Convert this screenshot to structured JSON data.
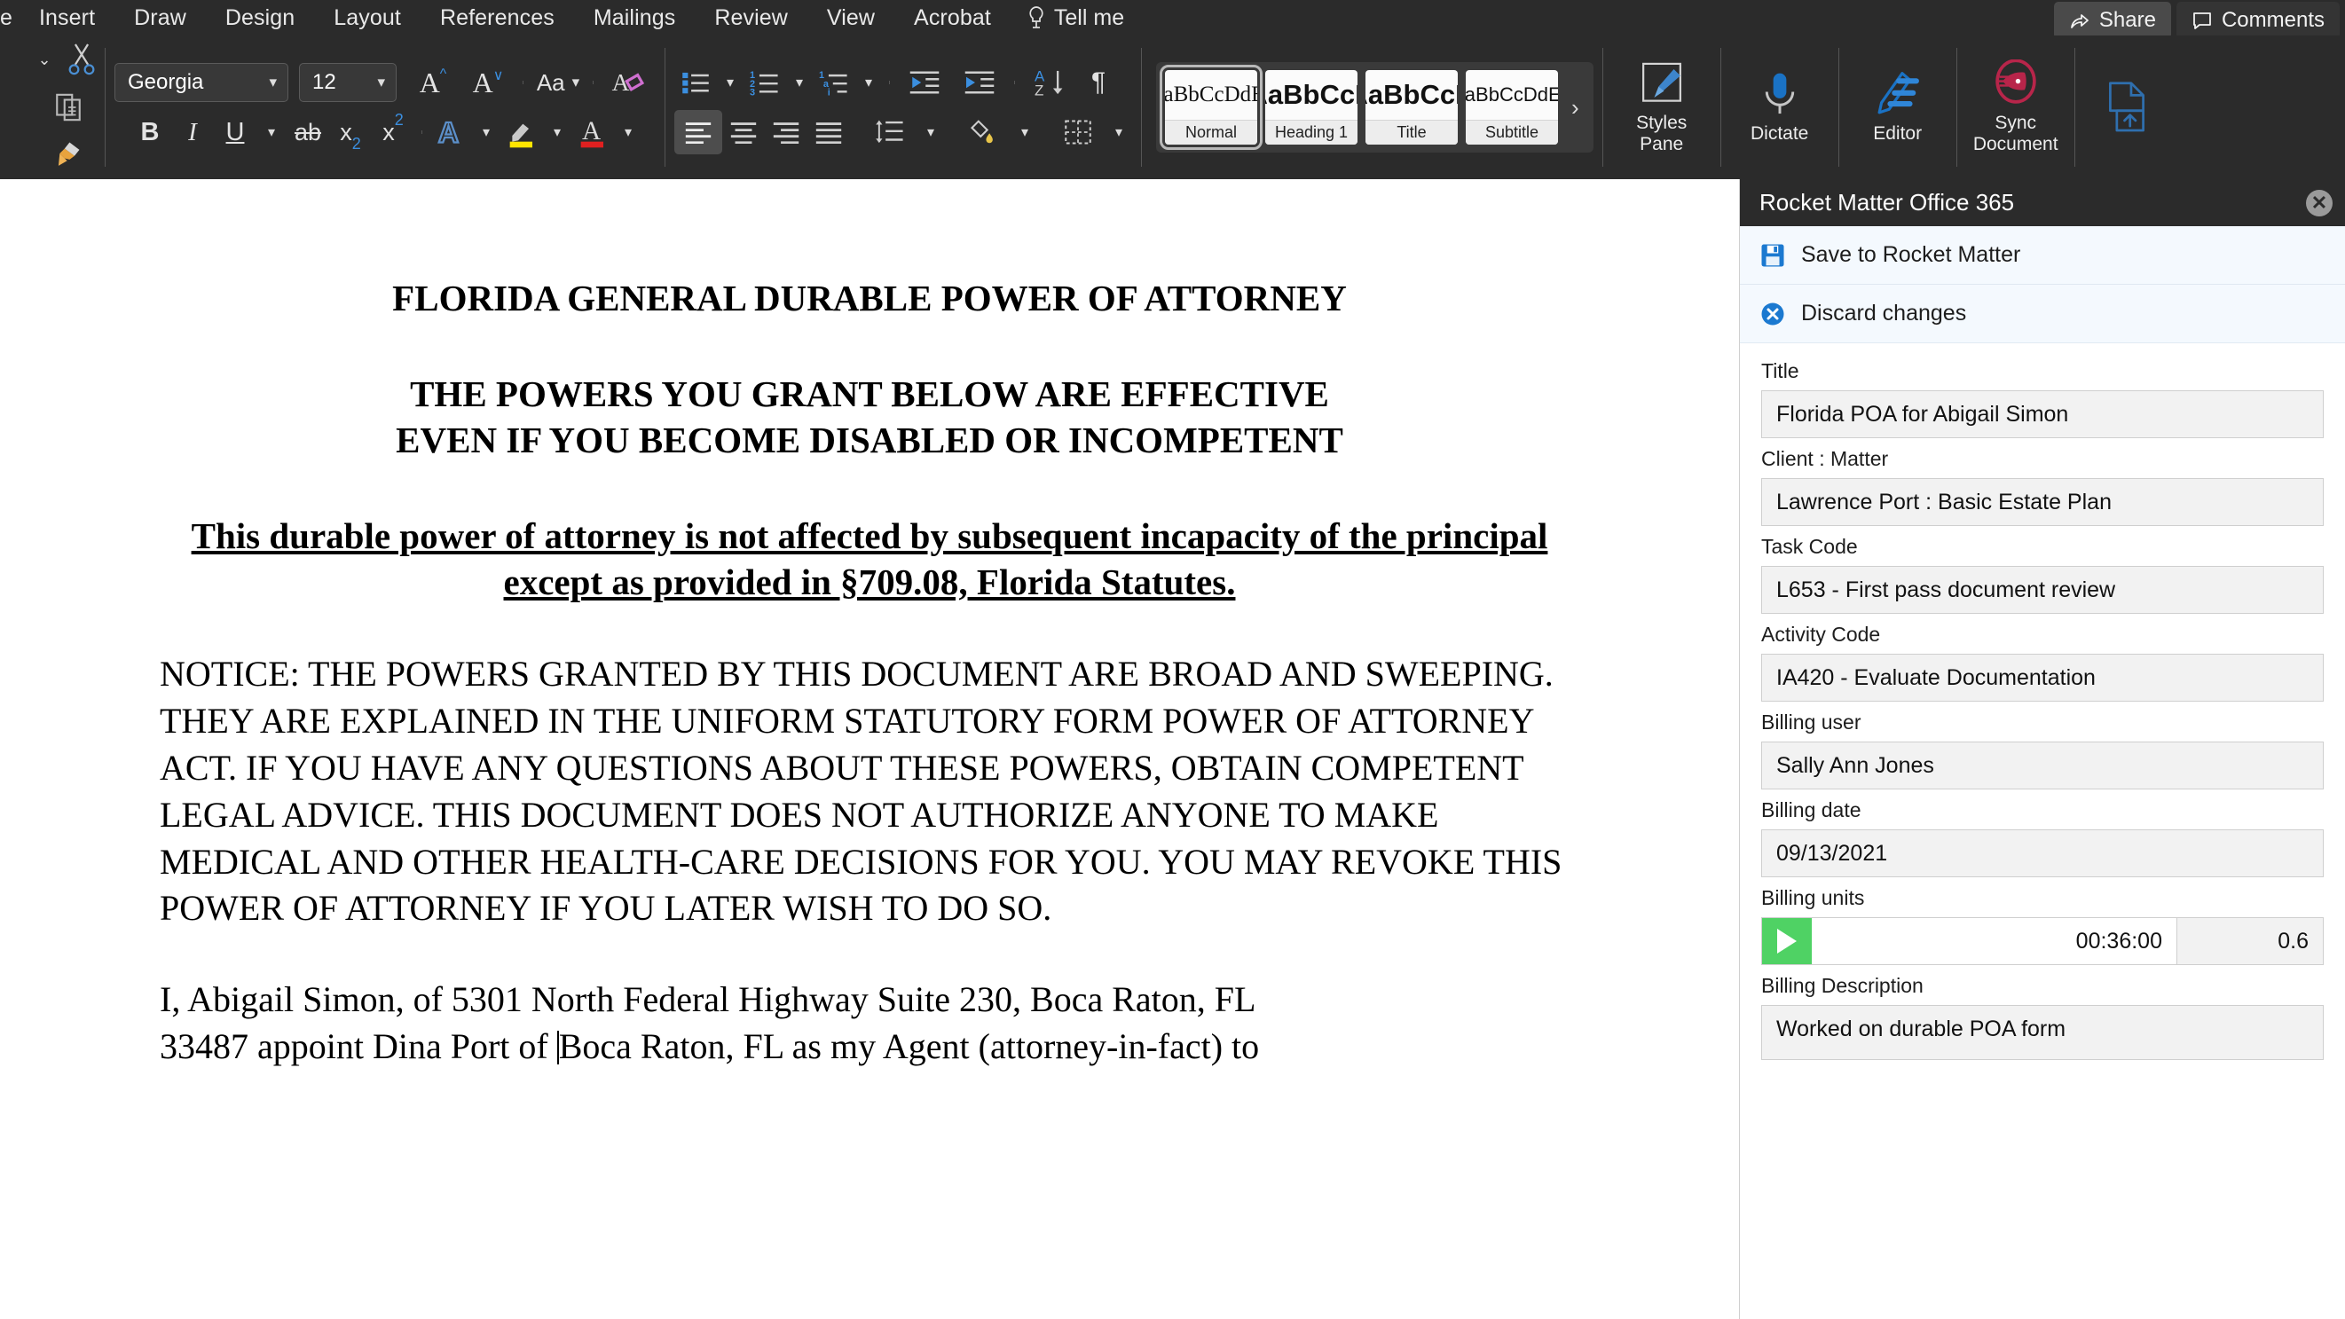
{
  "menubar": {
    "items": [
      {
        "label": "e",
        "name": "menu-home-partial"
      },
      {
        "label": "Insert",
        "name": "menu-insert"
      },
      {
        "label": "Draw",
        "name": "menu-draw"
      },
      {
        "label": "Design",
        "name": "menu-design"
      },
      {
        "label": "Layout",
        "name": "menu-layout"
      },
      {
        "label": "References",
        "name": "menu-references"
      },
      {
        "label": "Mailings",
        "name": "menu-mailings"
      },
      {
        "label": "Review",
        "name": "menu-review"
      },
      {
        "label": "View",
        "name": "menu-view"
      },
      {
        "label": "Acrobat",
        "name": "menu-acrobat"
      }
    ],
    "tell_me": "Tell me",
    "share": "Share",
    "comments": "Comments"
  },
  "ribbon": {
    "font_name": "Georgia",
    "font_size": "12",
    "styles": [
      {
        "preview": "AaBbCcDdEe",
        "label": "Normal",
        "size": "25px",
        "weight": "normal",
        "selected": true
      },
      {
        "preview": "AaBbCcD",
        "label": "Heading 1",
        "size": "32px",
        "weight": "bold",
        "selected": false
      },
      {
        "preview": "AaBbCcD",
        "label": "Title",
        "size": "32px",
        "weight": "bold",
        "selected": false
      },
      {
        "preview": "AaBbCcDdEe",
        "label": "Subtitle",
        "size": "24px",
        "weight": "normal",
        "selected": false
      }
    ],
    "gallery_more": "›",
    "styles_pane": "Styles\nPane",
    "dictate": "Dictate",
    "editor": "Editor",
    "sync_document": "Sync\nDocument",
    "accent_blue": "#2b7cd3",
    "rocket_red": "#b8254a"
  },
  "document": {
    "title_line": "FLORIDA GENERAL DURABLE POWER OF ATTORNEY",
    "subtitle_line1": "THE POWERS YOU GRANT BELOW ARE EFFECTIVE",
    "subtitle_line2": "EVEN IF YOU BECOME DISABLED OR INCOMPETENT",
    "underlined_paragraph": "This durable power of attorney is not affected by subsequent incapacity of the principal except as provided in §709.08, Florida Statutes.",
    "notice_paragraph": "NOTICE:  THE POWERS GRANTED BY THIS DOCUMENT ARE BROAD AND SWEEPING.  THEY ARE EXPLAINED IN THE UNIFORM STATUTORY FORM POWER OF ATTORNEY ACT. IF YOU HAVE ANY QUESTIONS ABOUT THESE POWERS, OBTAIN COMPETENT LEGAL ADVICE.  THIS DOCUMENT DOES NOT AUTHORIZE ANYONE TO MAKE MEDICAL AND OTHER HEALTH-CARE DECISIONS FOR YOU. YOU MAY REVOKE THIS POWER OF ATTORNEY IF YOU LATER WISH TO DO SO.",
    "body_line1": "I, Abigail Simon, of 5301 North Federal Highway Suite 230, Boca Raton, FL",
    "body_line2_a": "33487 appoint Dina Port of ",
    "body_line2_b": "Boca Raton, FL   as my Agent (attorney-in-fact) to"
  },
  "pane": {
    "title": "Rocket Matter Office 365",
    "close_label": "✕",
    "save_action": "Save to Rocket Matter",
    "discard_action": "Discard changes",
    "fields": {
      "title_label": "Title",
      "title_value": "Florida POA for Abigail Simon",
      "client_matter_label": "Client : Matter",
      "client_matter_value": "Lawrence Port : Basic Estate Plan",
      "task_code_label": "Task Code",
      "task_code_value": "L653 - First pass document review",
      "activity_code_label": "Activity Code",
      "activity_code_value": "IA420 - Evaluate Documentation",
      "billing_user_label": "Billing user",
      "billing_user_value": "Sally Ann Jones",
      "billing_date_label": "Billing date",
      "billing_date_value": "09/13/2021",
      "billing_units_label": "Billing units",
      "timer_value": "00:36:00",
      "units_value": "0.6",
      "billing_description_label": "Billing Description",
      "billing_description_value": "Worked on durable POA form"
    },
    "timer_green": "#4fd264",
    "accent_blue": "#1b79d0"
  }
}
